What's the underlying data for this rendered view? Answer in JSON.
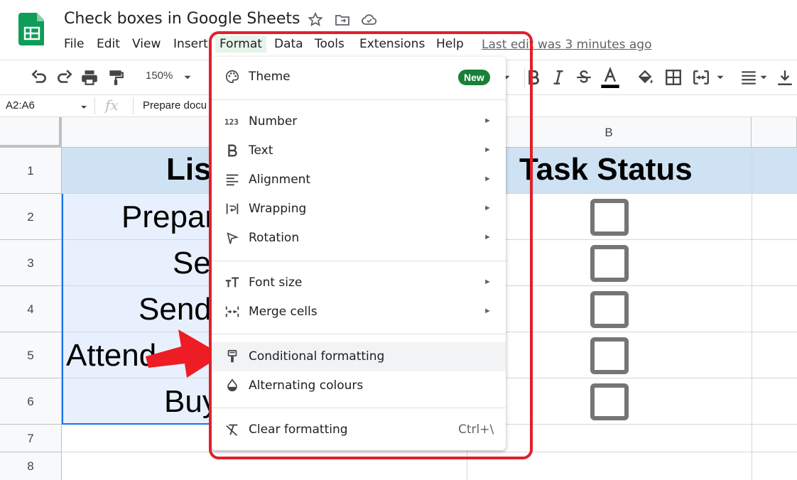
{
  "app": {
    "title": "Check boxes in Google Sheets",
    "last_edit": "Last edit was 3 minutes ago"
  },
  "menubar": [
    "File",
    "Edit",
    "View",
    "Insert",
    "Format",
    "Data",
    "Tools",
    "Extensions",
    "Help"
  ],
  "toolbar": {
    "zoom": "150%",
    "icons": [
      "undo-icon",
      "redo-icon",
      "print-icon",
      "paint-format-icon",
      "bold-icon",
      "italic-icon",
      "strikethrough-icon",
      "text-color-icon",
      "fill-color-icon",
      "borders-icon",
      "merge-icon",
      "align-icon",
      "valign-icon"
    ]
  },
  "formula_bar": {
    "name_box": "A2:A6",
    "fx": "fx",
    "formula": "Prepare docu"
  },
  "columns": {
    "b": "B"
  },
  "rows": [
    "1",
    "2",
    "3",
    "4",
    "5",
    "6",
    "7",
    "8"
  ],
  "cells": {
    "a1": "Lis",
    "b1": "Task Status",
    "a2": "Prepar",
    "a3": "Se",
    "a4": "Send",
    "a5": "Attend",
    "a6": "Buy"
  },
  "checkboxes": [
    false,
    false,
    false,
    false,
    false
  ],
  "format_menu": {
    "theme": "Theme",
    "new_badge": "New",
    "number": "Number",
    "text": "Text",
    "alignment": "Alignment",
    "wrapping": "Wrapping",
    "rotation": "Rotation",
    "font_size": "Font size",
    "merge_cells": "Merge cells",
    "conditional_formatting": "Conditional formatting",
    "alternating_colours": "Alternating colours",
    "clear_formatting": "Clear formatting",
    "clear_shortcut": "Ctrl+\\"
  },
  "colors": {
    "accent_green": "#188038",
    "highlight_red": "#e0202a",
    "header_fill": "#cfe2f3",
    "selected_fill": "#e8f0fe"
  }
}
